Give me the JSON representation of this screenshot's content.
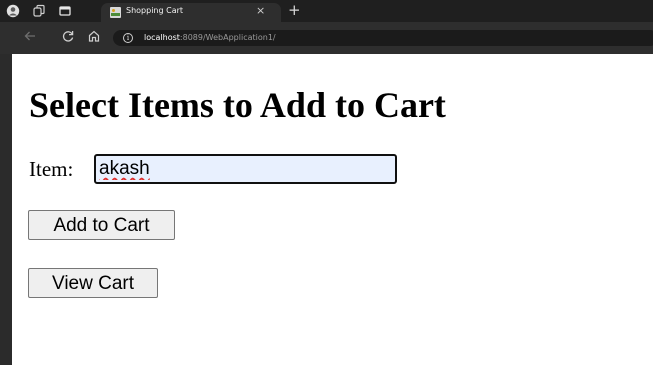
{
  "browser": {
    "tab": {
      "title": "Shopping Cart",
      "close_glyph": "×",
      "favicon": "image-file-icon"
    },
    "new_tab_glyph": "+",
    "address": {
      "host": "localhost",
      "path": ":8089/WebApplication1/"
    },
    "icons": [
      "profile-icon",
      "workspaces-icon",
      "tab-actions-icon",
      "back-icon",
      "reload-icon",
      "home-icon",
      "site-info-icon"
    ]
  },
  "page": {
    "title": "Select Items to Add to Cart",
    "item_label": "Item:",
    "item_input_value": "akash",
    "add_button_label": "Add to Cart",
    "view_button_label": "View Cart"
  },
  "colors": {
    "chrome_dark": "#1f1f1f",
    "toolbar": "#2e2e2e",
    "input_autofill_bg": "#e8f0fe",
    "button_bg": "#efefef"
  }
}
